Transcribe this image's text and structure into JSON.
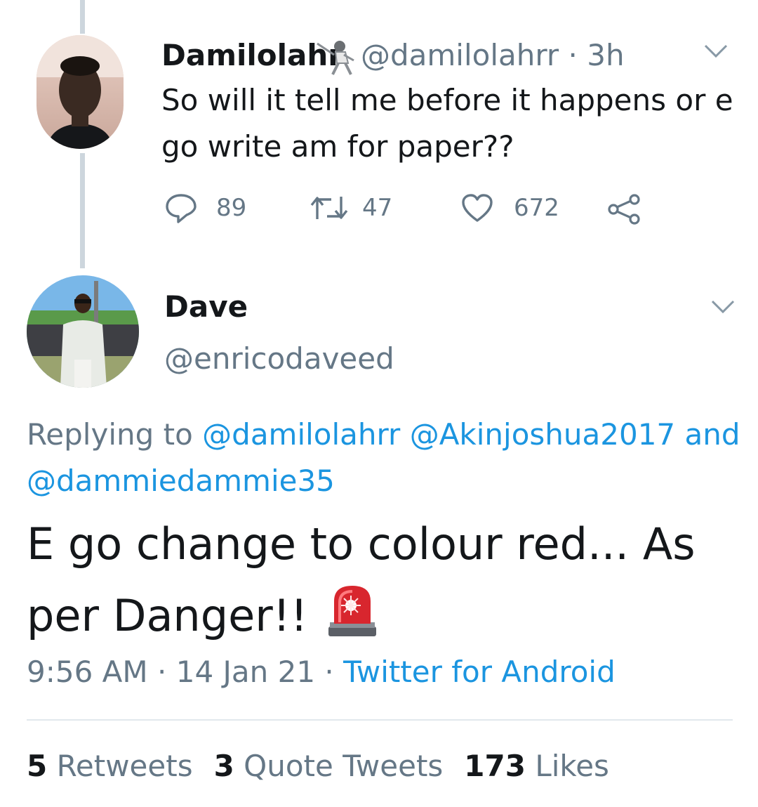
{
  "parent_tweet": {
    "display_name": "Damilolahr",
    "handle": "@damilolahrr",
    "separator": "·",
    "time": "3h",
    "text_line1": "So will it tell me before it happens or e",
    "text_line2": "go write am for paper??",
    "replies": "89",
    "retweets": "47",
    "likes": "672",
    "name_emoji_icon": "fencer-icon"
  },
  "main_tweet": {
    "display_name": "Dave",
    "handle": "@enricodaveed",
    "replying_prefix": "Replying to",
    "reply_mentions": [
      "@damilolahrr",
      "@Akinjoshua2017",
      "and",
      "@dammiedammie35"
    ],
    "text_line1": "E go change to colour red... As",
    "text_line2": "per Danger!!",
    "text_emoji_icon": "police-light-icon",
    "time": "9:56 AM",
    "sep1": "·",
    "date": "14 Jan 21",
    "sep2": "·",
    "source": "Twitter for Android"
  },
  "stats": {
    "retweets_count": "5",
    "retweets_label": "Retweets",
    "quotes_count": "3",
    "quotes_label": "Quote Tweets",
    "likes_count": "173",
    "likes_label": "Likes"
  },
  "colors": {
    "link": "#1b95e0",
    "muted": "#657786",
    "text": "#14171a",
    "thread_line": "#cdd6dd"
  }
}
